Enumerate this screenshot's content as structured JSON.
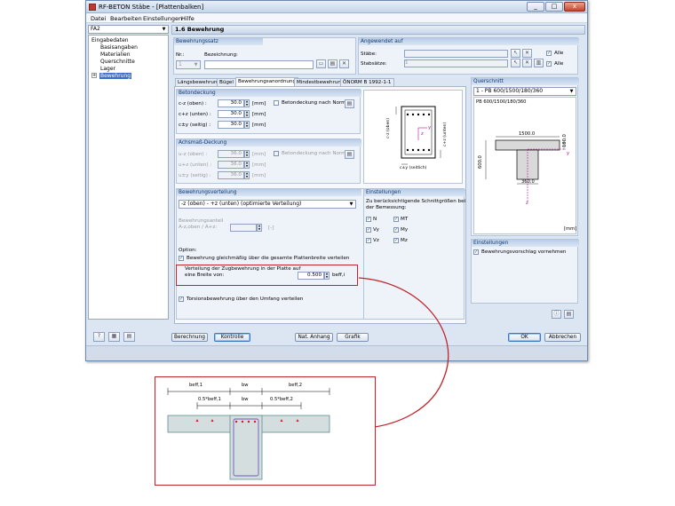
{
  "window": {
    "title": "RF-BETON Stäbe - [Plattenbalken]",
    "controls": [
      "_",
      "□",
      "x"
    ]
  },
  "menu": [
    "Datei",
    "Bearbeiten",
    "Einstellungen",
    "Hilfe"
  ],
  "case_combo": {
    "value": "FA2"
  },
  "section_header": "1.6 Bewehrung",
  "tree": {
    "root": "Eingabedaten",
    "items": [
      "Basisangaben",
      "Materialien",
      "Querschnitte",
      "Lager",
      "Bewehrung"
    ],
    "expander": "+"
  },
  "bewehrungssatz": {
    "title": "Bewehrungssatz",
    "nr_label": "Nr.:",
    "nr_value": "1",
    "bez_label": "Bezeichnung:"
  },
  "angewendet": {
    "title": "Angewendet auf",
    "staebe_label": "Stäbe:",
    "staebe_value": "",
    "stabsaetze_label": "Stabsätze:",
    "stabsaetze_value": "1",
    "alle": "Alle"
  },
  "tabs": [
    "Längsbewehrung",
    "Bügel",
    "Bewehrungsanordnung",
    "Mindestbewehrung",
    "ÖNORM B 1992-1-1"
  ],
  "betondeckung": {
    "title": "Betondeckung",
    "rows": [
      {
        "label": "c-z (oben) :",
        "value": "30.0",
        "unit": "[mm]"
      },
      {
        "label": "c+z (unten) :",
        "value": "30.0",
        "unit": "[mm]"
      },
      {
        "label": "c±y (seitig) :",
        "value": "30.0",
        "unit": "[mm]"
      }
    ],
    "nach_norm": "Betondeckung nach Norm"
  },
  "achsmass": {
    "title": "Achsmaß-Deckung",
    "rows": [
      {
        "label": "u-z (oben) :",
        "value": "36.0",
        "unit": "[mm]"
      },
      {
        "label": "u+z (unten) :",
        "value": "36.0",
        "unit": "[mm]"
      },
      {
        "label": "u±y (seitig) :",
        "value": "36.0",
        "unit": "[mm]"
      }
    ],
    "nach_norm": "Betondeckung nach Norm"
  },
  "cross_diagram": {
    "c_oben": "c-z (oben)",
    "c_unten": "c+z (unten)",
    "c_seitlich": "c±y (seitlich)",
    "y": "y",
    "z": "z"
  },
  "bewehrungsverteilung": {
    "title": "Bewehrungsverteilung",
    "select": "-z (oben) - +z (unten) (optimierte Verteilung)",
    "anteil_label1": "Bewehrungsanteil",
    "anteil_label2": "A-z,oben / A+z:",
    "anteil_unit": "[-]",
    "option_label": "Option:",
    "gleichmaessig": "Bewehrung gleichmäßig über die gesamte Plattenbreite verteilen",
    "verteilung_line1": "Verteilung der Zugbewehrung in der Platte auf",
    "verteilung_line2": "eine Breite von:",
    "breite_value": "0.500",
    "breite_unit": "beff,i",
    "torsion": "Torsionsbewehrung über den Umfang verteilen"
  },
  "einstellungen_mid": {
    "title": "Einstellungen",
    "desc1": "Zu berücksichtigende Schnittgrößen bei",
    "desc2": "der Bemessung:",
    "forces": [
      "N",
      "MT",
      "Vy",
      "My",
      "Vz",
      "Mz"
    ]
  },
  "querschnitt": {
    "title": "Querschnitt",
    "select": "1 - PB 600/1500/180/360",
    "name": "PB 600/1500/180/360",
    "dim_top": "1500.0",
    "dim_flange": "180.0",
    "dim_height": "600.0",
    "dim_web": "360.0",
    "unit": "[mm]",
    "y": "y",
    "z": "z"
  },
  "einstellungen_right": {
    "title": "Einstellungen",
    "vorschlag": "Bewehrungsvorschlag vornehmen"
  },
  "buttons": {
    "berechnung": "Berechnung",
    "kontrolle": "Kontrolle",
    "nat_anhang": "Nat. Anhang",
    "grafik": "Grafik",
    "ok": "OK",
    "abbrechen": "Abbrechen"
  },
  "detail": {
    "beff1": "beff,1",
    "bw_top": "bw",
    "beff2": "beff,2",
    "half1": "0.5*beff,1",
    "bw_mid": "bw",
    "half2": "0.5*beff,2"
  },
  "colors": {
    "highlight": "#c0242b",
    "accent": "#3e6fc0",
    "panel": "#eef3fa",
    "concrete": "#d4dede"
  }
}
